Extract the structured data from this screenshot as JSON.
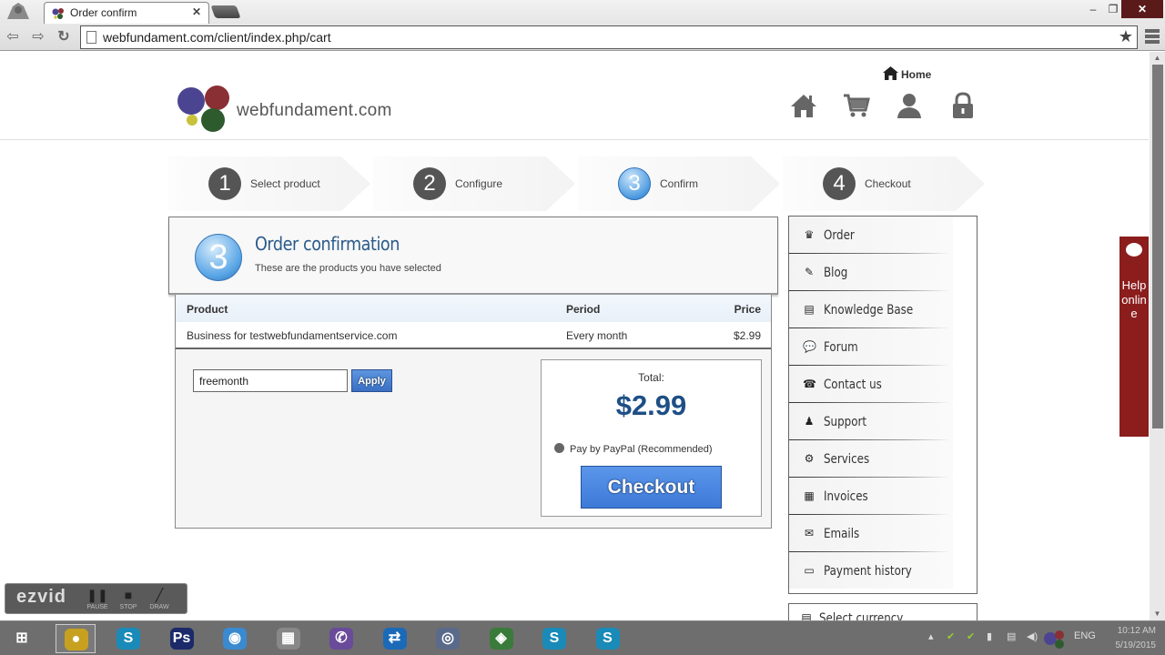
{
  "browser": {
    "tab_title": "Order confirm",
    "url": "webfundament.com/client/index.php/cart",
    "window_controls": {
      "minimize": "–",
      "maximize": "❐",
      "close": "✕"
    }
  },
  "header": {
    "logo_text": "webfundament.com",
    "logo_colors": [
      "#4b4591",
      "#8a2f34",
      "#2e5b2e",
      "#c8c23a"
    ],
    "home_link": "Home",
    "icons": [
      "home-icon",
      "cart-icon",
      "user-icon",
      "lock-icon"
    ]
  },
  "steps": [
    {
      "number": "1",
      "label": "Select product",
      "active": false
    },
    {
      "number": "2",
      "label": "Configure",
      "active": false
    },
    {
      "number": "3",
      "label": "Confirm",
      "active": true
    },
    {
      "number": "4",
      "label": "Checkout",
      "active": false
    }
  ],
  "confirmation": {
    "step_number": "3",
    "title": "Order confirmation",
    "subtitle": "These are the products you have selected"
  },
  "order_table": {
    "columns": [
      "Product",
      "Period",
      "Price"
    ],
    "rows": [
      {
        "product": "Business for testwebfundamentservice.com",
        "period": "Every month",
        "price": "$2.99"
      }
    ]
  },
  "promo": {
    "value": "freemonth",
    "apply_label": "Apply"
  },
  "total": {
    "label": "Total:",
    "value": "$2.99",
    "payment_option": "Pay by PayPal (Recommended)",
    "checkout_label": "Checkout"
  },
  "sidebar": {
    "items": [
      {
        "label": "Order",
        "icon": "basket-icon"
      },
      {
        "label": "Blog",
        "icon": "edit-icon"
      },
      {
        "label": "Knowledge Base",
        "icon": "book-icon"
      },
      {
        "label": "Forum",
        "icon": "chat-icon"
      },
      {
        "label": "Contact us",
        "icon": "phone-icon"
      },
      {
        "label": "Support",
        "icon": "support-icon"
      },
      {
        "label": "Services",
        "icon": "gear-icon"
      },
      {
        "label": "Invoices",
        "icon": "invoice-icon"
      },
      {
        "label": "Emails",
        "icon": "envelope-icon"
      },
      {
        "label": "Payment history",
        "icon": "card-icon"
      }
    ],
    "currency_label": "Select currency"
  },
  "help_online": {
    "label": "Help online"
  },
  "ezvid": {
    "logo": "ezvid",
    "buttons": [
      "PAUSE",
      "STOP",
      "DRAW"
    ]
  },
  "taskbar": {
    "apps": [
      {
        "name": "start",
        "glyph": "⊞",
        "color": "#6e6e6e"
      },
      {
        "name": "chrome",
        "glyph": "●",
        "color": "#c8a020",
        "active": true
      },
      {
        "name": "skype",
        "glyph": "S",
        "color": "#1a8ab8"
      },
      {
        "name": "photoshop",
        "glyph": "Ps",
        "color": "#1c2a6a"
      },
      {
        "name": "browser-globe",
        "glyph": "◉",
        "color": "#3a8ad0"
      },
      {
        "name": "calculator",
        "glyph": "▦",
        "color": "#888"
      },
      {
        "name": "viber",
        "glyph": "✆",
        "color": "#6a4a9a"
      },
      {
        "name": "teamviewer",
        "glyph": "⇄",
        "color": "#1a6ab8"
      },
      {
        "name": "app-sphere",
        "glyph": "◎",
        "color": "#5a6a8a"
      },
      {
        "name": "app-map",
        "glyph": "◈",
        "color": "#3a7a3a"
      },
      {
        "name": "skype-2",
        "glyph": "S",
        "color": "#1a8ab8"
      },
      {
        "name": "skype-3",
        "glyph": "S",
        "color": "#1a8ab8"
      }
    ],
    "tray_lang": "ENG",
    "clock_time": "10:12 AM",
    "clock_date": "5/19/2015"
  }
}
